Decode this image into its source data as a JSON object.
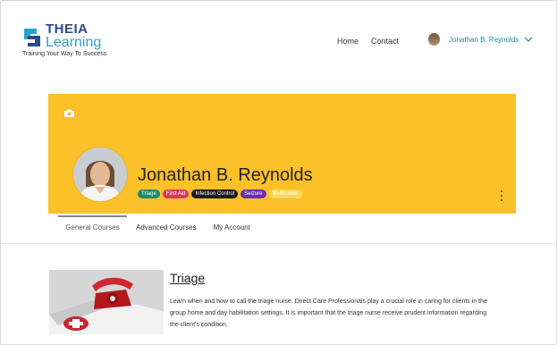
{
  "header": {
    "logo_theia": "THEIA",
    "logo_learning": "Learning",
    "tagline": "Training Your Way To Success",
    "nav": {
      "home": "Home",
      "contact": "Contact"
    },
    "user_name": "Jonathan B. Reynolds"
  },
  "profile": {
    "name": "Jonathan B. Reynolds",
    "tags": [
      {
        "label": "Triage",
        "color": "#1d8a6b"
      },
      {
        "label": "First Aid",
        "color": "#d63a5c"
      },
      {
        "label": "Infection Control",
        "color": "#1a1a1a"
      },
      {
        "label": "Seizure",
        "color": "#6a2fb4"
      },
      {
        "label": "Medication",
        "color": "#f5d75a"
      }
    ]
  },
  "tabs": {
    "general": "General Courses",
    "advanced": "Advanced Courses",
    "account": "My Account"
  },
  "course": {
    "title": "Triage",
    "description": "Learn when and how to call the triage nurse. Direct Care Professionals play a crucial role in caring for clients in the group home and day habilitation settings. It is important that the triage nurse receive prudent information regarding the client's condition."
  },
  "colors": {
    "banner": "#fcc129",
    "accent": "#1f8a8a"
  }
}
